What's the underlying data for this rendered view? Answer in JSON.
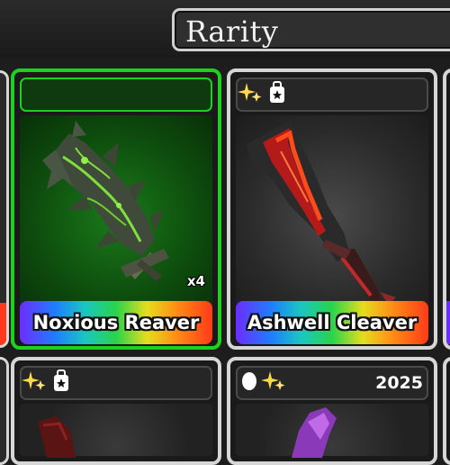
{
  "header": {
    "sort_label": "Rarity"
  },
  "cards": [
    {
      "name": "Noxious Reaver",
      "quantity": "x4"
    },
    {
      "name": "Ashwell Cleaver"
    },
    {},
    {
      "year": "2025"
    }
  ],
  "colors": {
    "selected_border": "#1fd11f",
    "selected_body": "#0d4a0d",
    "card_border": "#d6d6d6",
    "name_bar_gradient": [
      "#6d2cff",
      "#1f7cff",
      "#19c7c0",
      "#29d44a",
      "#e6dd1d",
      "#ff8a14",
      "#ff3a1a"
    ]
  },
  "icons": [
    "sparkle-icon",
    "chroma-tag-icon",
    "egg-icon"
  ]
}
